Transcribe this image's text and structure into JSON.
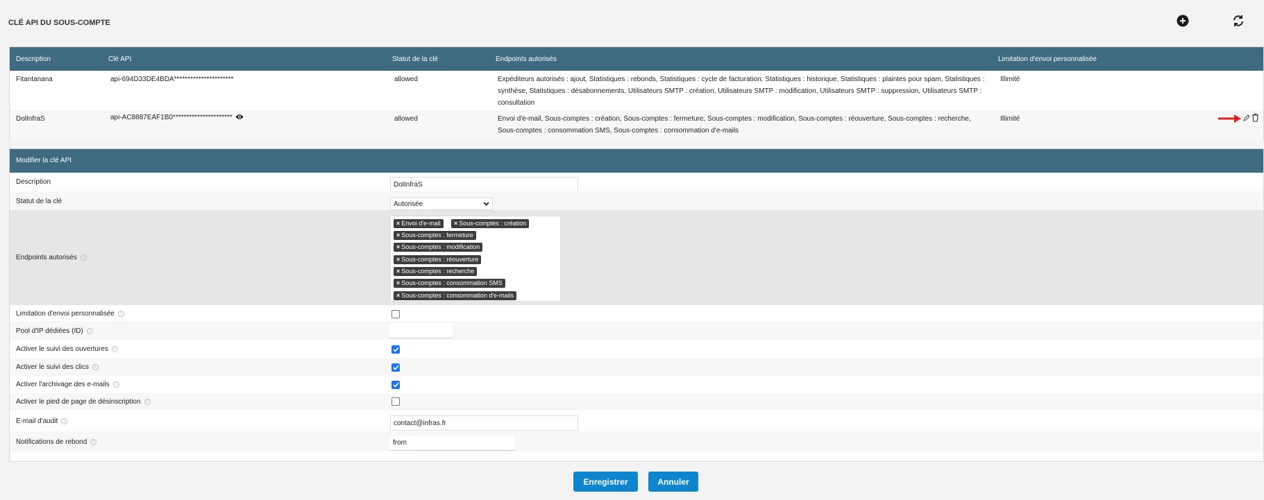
{
  "page": {
    "title": "CLÉ API DU SOUS-COMPTE"
  },
  "icons": {
    "add": "plus-circle-icon",
    "refresh": "refresh-icon",
    "eye": "eye-icon",
    "edit": "pencil-icon",
    "delete": "trash-icon",
    "info": "info-icon",
    "arrow": "red-arrow-icon"
  },
  "table": {
    "headers": [
      "Description",
      "Clé API",
      "Statut de la clé",
      "Endpoints autorisés",
      "Limitation d'envoi personnalisée"
    ],
    "rows": [
      {
        "description": "Fitantanana",
        "key": "api-694D33DE4BDA**********************",
        "status": "allowed",
        "endpoints": "Expéditeurs autorisés : ajout, Statistiques : rebonds, Statistiques : cycle de facturation, Statistiques : historique, Statistiques : plaintes pour spam, Statistiques : synthèse, Statistiques : désabonnements, Utilisateurs SMTP : création, Utilisateurs SMTP : modification, Utilisateurs SMTP : suppression, Utilisateurs SMTP : consultation",
        "limit": "Illimité"
      },
      {
        "description": "DolInfraS",
        "key": "api-AC8887EAF1B0**********************",
        "status": "allowed",
        "endpoints": "Envoi d'e-mail, Sous-comptes : création, Sous-comptes : fermeture, Sous-comptes : modification, Sous-comptes : réouverture, Sous-comptes : recherche, Sous-comptes : consommation SMS, Sous-comptes : consommation d'e-mails",
        "limit": "Illimité"
      }
    ]
  },
  "form": {
    "title": "Modifier la clé API",
    "description": {
      "label": "Description",
      "value": "DolInfraS"
    },
    "status": {
      "label": "Statut de la clé",
      "value": "Autorisée"
    },
    "endpoints": {
      "label": "Endpoints autorisés",
      "tags": [
        "Envoi d'e-mail",
        "Sous-comptes : création",
        "Sous-comptes : fermeture",
        "Sous-comptes : modification",
        "Sous-comptes : réouverture",
        "Sous-comptes : recherche",
        "Sous-comptes : consommation SMS",
        "Sous-comptes : consommation d'e-mails"
      ]
    },
    "custom_limit": {
      "label": "Limitation d'envoi personnalisée",
      "checked": false
    },
    "ip_pool": {
      "label": "Pool d'IP dédiées (ID)",
      "value": ""
    },
    "track_opens": {
      "label": "Activer le suivi des ouvertures",
      "checked": true
    },
    "track_clicks": {
      "label": "Activer le suivi des clics",
      "checked": true
    },
    "archiving": {
      "label": "Activer l'archivage des e-mails",
      "checked": true
    },
    "unsub_footer": {
      "label": "Activer le pied de page de désinscription",
      "checked": false
    },
    "audit_email": {
      "label": "E-mail d'audit",
      "value": "contact@infras.fr"
    },
    "bounce_notif": {
      "label": "Notifications de rebond",
      "value": "from"
    }
  },
  "buttons": {
    "save": "Enregistrer",
    "cancel": "Annuler"
  },
  "colors": {
    "header_bg": "#3e6b80",
    "button_bg": "#0f85cf",
    "tag_bg": "#3d3d3d",
    "checkbox_on": "#1e73e8",
    "arrow": "#e02020"
  }
}
